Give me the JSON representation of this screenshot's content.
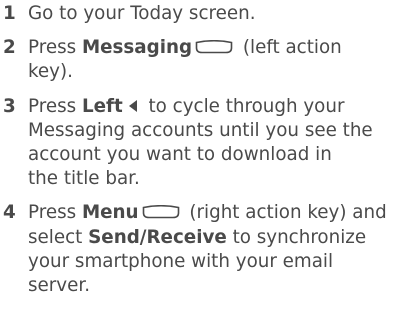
{
  "steps": [
    {
      "number": "1",
      "text": "Go to your Today screen."
    },
    {
      "number": "2",
      "prefix": "Press ",
      "bold": "Messaging",
      "icon": "left-action-key-icon",
      "suffix_line1": " (left action",
      "suffix_line2": "key)."
    },
    {
      "number": "3",
      "prefix": "Press ",
      "bold": "Left",
      "icon": "left-arrow-icon",
      "suffix_line1": " to cycle through your",
      "lines": [
        "Messaging accounts until you see the",
        "account you want to download in",
        "the title bar."
      ]
    },
    {
      "number": "4",
      "prefix": "Press ",
      "bold": "Menu",
      "icon": "right-action-key-icon",
      "suffix_line1": " (right action key) and",
      "line2_prefix": "select ",
      "line2_bold": "Send/Receive",
      "line2_suffix": " to synchronize",
      "lines": [
        "your smartphone with your email",
        "server."
      ]
    }
  ],
  "colors": {
    "text": "#4a4a4a"
  }
}
